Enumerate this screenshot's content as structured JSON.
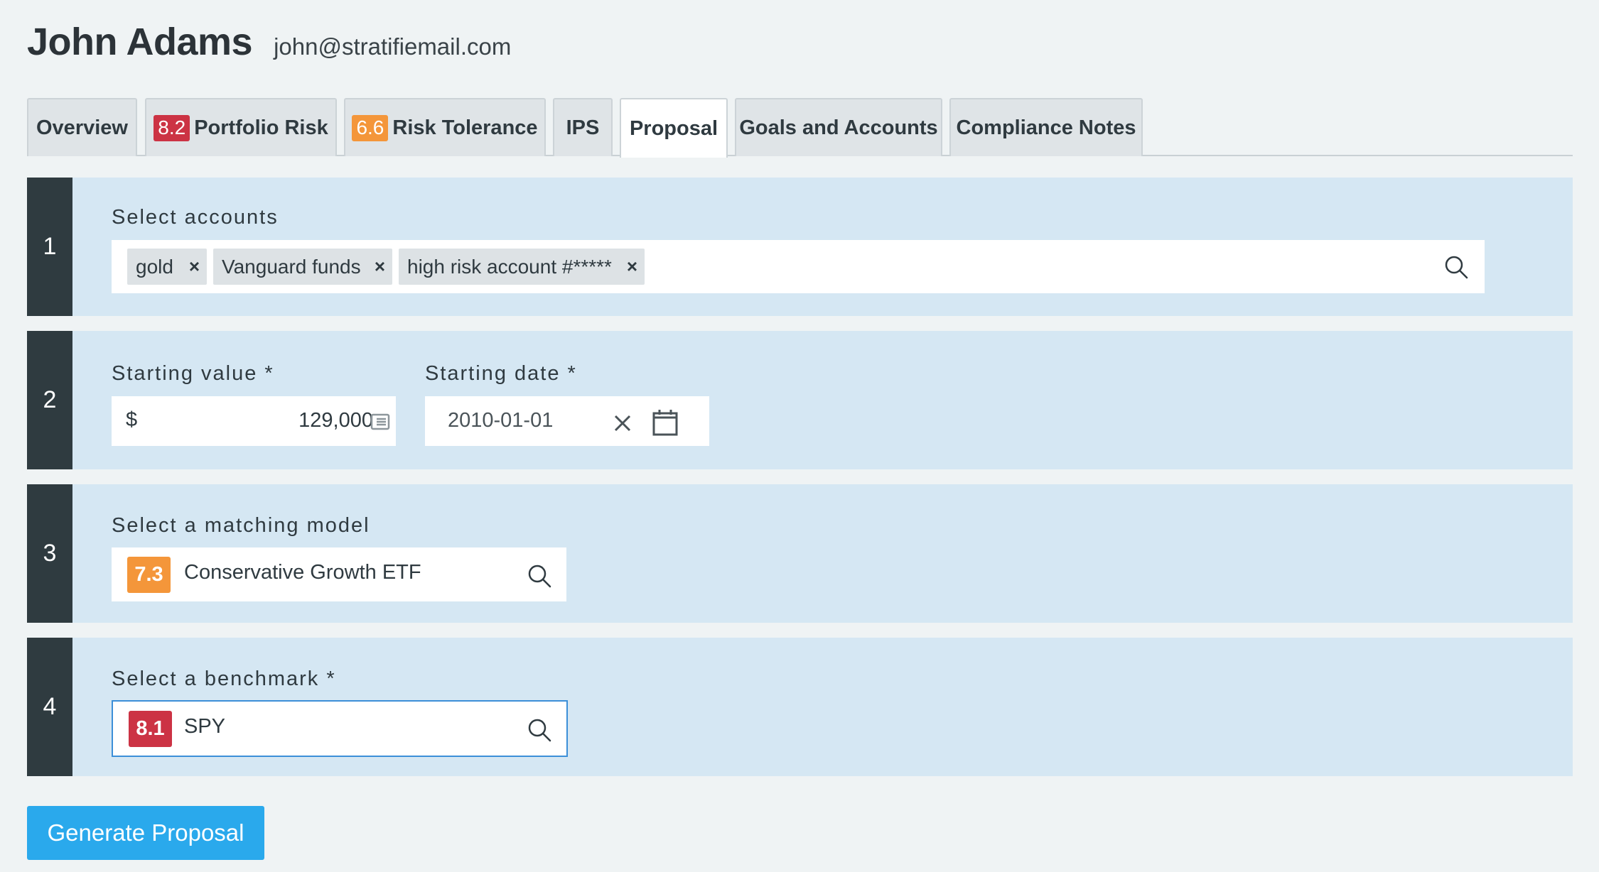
{
  "client": {
    "name": "John Adams",
    "email": "john@stratifiemail.com"
  },
  "tabs": [
    {
      "label": "Overview"
    },
    {
      "label": "Portfolio Risk",
      "score": "8.2",
      "score_color": "#cc3344"
    },
    {
      "label": "Risk Tolerance",
      "score": "6.6",
      "score_color": "#f4963a"
    },
    {
      "label": "IPS"
    },
    {
      "label": "Proposal",
      "active": true
    },
    {
      "label": "Goals and Accounts"
    },
    {
      "label": "Compliance Notes"
    }
  ],
  "steps": {
    "step1": {
      "number": "1",
      "label": "Select accounts",
      "tokens": [
        "gold",
        "Vanguard funds",
        "high risk account #*****"
      ],
      "remove_glyph": "×"
    },
    "step2": {
      "number": "2",
      "starting_value_label": "Starting value *",
      "currency_symbol": "$",
      "starting_value": "129,000",
      "starting_date_label": "Starting date *",
      "starting_date": "2010-01-01"
    },
    "step3": {
      "number": "3",
      "label": "Select a matching model",
      "model_score": "7.3",
      "model_score_color": "#f4963a",
      "model_name": "Conservative Growth ETF"
    },
    "step4": {
      "number": "4",
      "label": "Select a benchmark *",
      "benchmark_score": "8.1",
      "benchmark_score_color": "#cc3344",
      "benchmark_name": "SPY"
    }
  },
  "actions": {
    "generate_label": "Generate Proposal"
  },
  "colors": {
    "accent": "#2aa9ec",
    "step_bg": "#d5e7f3",
    "step_number_bg": "#2f3b40",
    "score_red": "#cc3344",
    "score_orange": "#f4963a"
  },
  "icons": {
    "search": "search-icon",
    "clear": "close-icon",
    "calendar": "calendar-icon",
    "calculator": "calculator-icon"
  }
}
